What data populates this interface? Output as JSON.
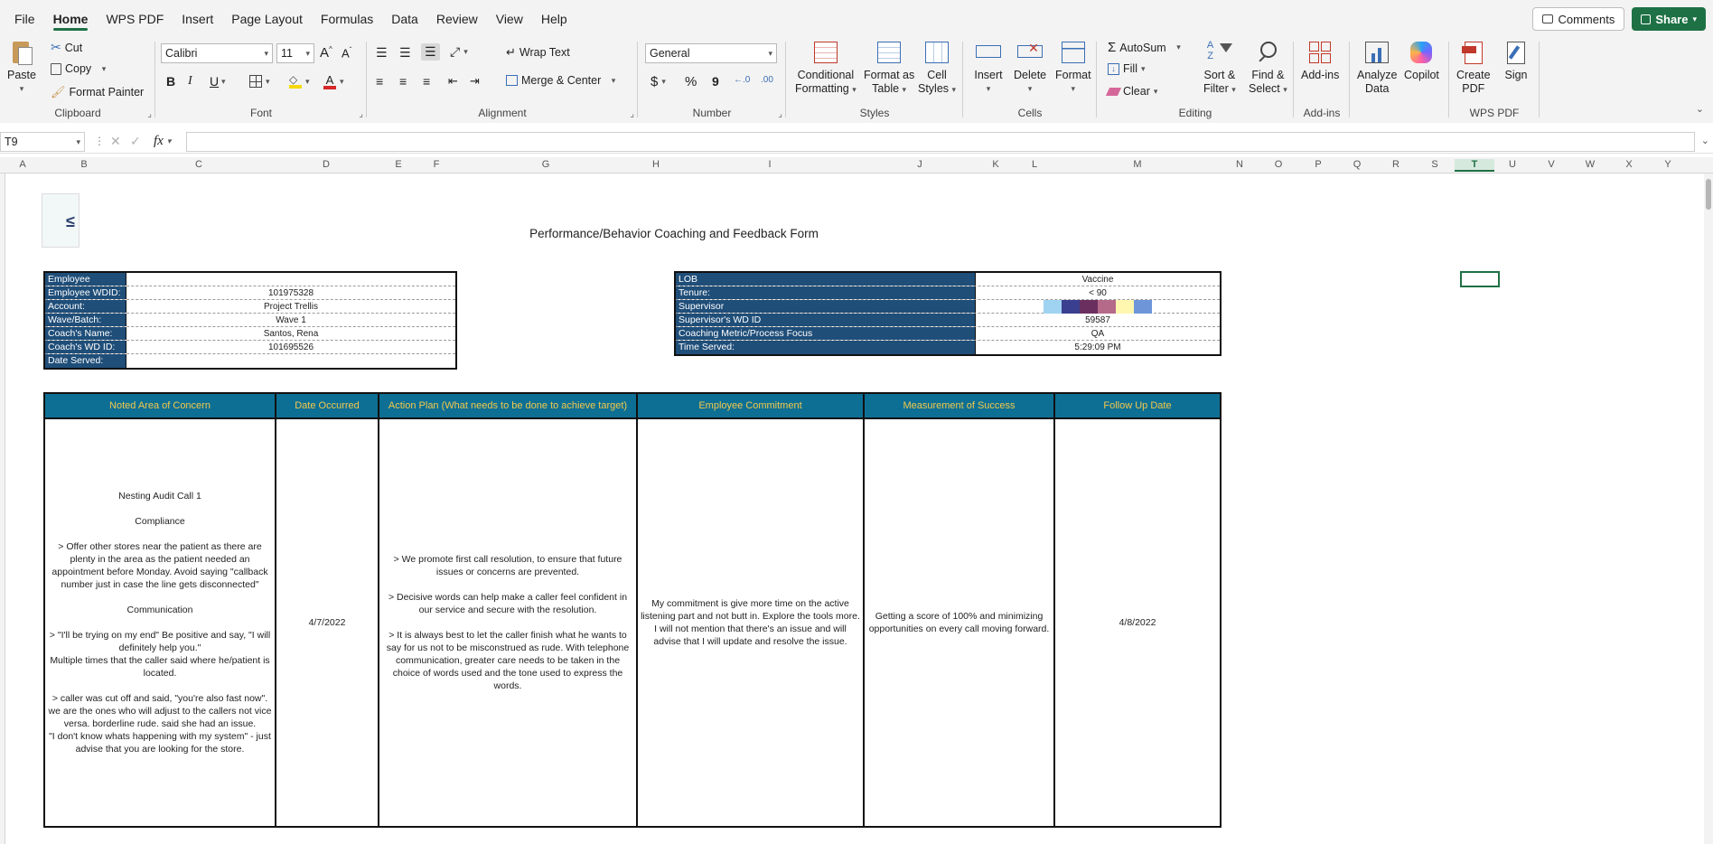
{
  "menu": {
    "tabs": [
      "File",
      "Home",
      "WPS PDF",
      "Insert",
      "Page Layout",
      "Formulas",
      "Data",
      "Review",
      "View",
      "Help"
    ],
    "comments_label": "Comments",
    "share_label": "Share"
  },
  "ribbon": {
    "clipboard": {
      "label": "Clipboard",
      "paste": "Paste",
      "cut": "Cut",
      "copy": "Copy",
      "format_painter": "Format Painter"
    },
    "font": {
      "label": "Font",
      "name": "Calibri",
      "size": "11",
      "bold": "B",
      "italic": "I",
      "underline": "U"
    },
    "alignment": {
      "label": "Alignment",
      "wrap": "Wrap Text",
      "merge": "Merge & Center"
    },
    "number": {
      "label": "Number",
      "format": "General",
      "currency": "$",
      "percent": "%",
      "comma": "9"
    },
    "styles": {
      "label": "Styles",
      "conditional_1": "Conditional",
      "conditional_2": "Formatting",
      "format_table_1": "Format as",
      "format_table_2": "Table",
      "cell_styles_1": "Cell",
      "cell_styles_2": "Styles"
    },
    "cells": {
      "label": "Cells",
      "insert": "Insert",
      "delete": "Delete",
      "format": "Format"
    },
    "editing": {
      "label": "Editing",
      "autosum": "AutoSum",
      "fill": "Fill",
      "clear": "Clear",
      "sort_1": "Sort &",
      "sort_2": "Filter",
      "find_1": "Find &",
      "find_2": "Select"
    },
    "addins": {
      "label": "Add-ins",
      "addins": "Add-ins",
      "analyze_1": "Analyze",
      "analyze_2": "Data",
      "copilot": "Copilot"
    },
    "wpspdf": {
      "label": "WPS PDF",
      "create_1": "Create",
      "create_2": "PDF",
      "sign": "Sign"
    }
  },
  "formula_bar": {
    "cell_ref": "T9",
    "fx": "fx",
    "content": ""
  },
  "columns": [
    "A",
    "B",
    "C",
    "D",
    "E",
    "F",
    "G",
    "H",
    "I",
    "J",
    "K",
    "L",
    "M",
    "N",
    "O",
    "P",
    "Q",
    "R",
    "S",
    "T",
    "U",
    "V",
    "W",
    "X",
    "Y"
  ],
  "sheet": {
    "title": "Performance/Behavior Coaching and Feedback Form",
    "logo_glyph": "≤",
    "left_info": [
      {
        "label": "Employee",
        "value": ""
      },
      {
        "label": "Employee WDID:",
        "value": "101975328"
      },
      {
        "label": "Account:",
        "value": "Project Trellis"
      },
      {
        "label": "Wave/Batch:",
        "value": "Wave 1"
      },
      {
        "label": "Coach's Name:",
        "value": "Santos, Rena"
      },
      {
        "label": "Coach's WD ID:",
        "value": "101695526"
      },
      {
        "label": "Date Served:",
        "value": ""
      }
    ],
    "right_info": [
      {
        "label": "LOB",
        "value": "Vaccine"
      },
      {
        "label": "Tenure:",
        "value": "< 90"
      },
      {
        "label": "Supervisor",
        "value": ""
      },
      {
        "label": "Supervisor's WD ID",
        "value": "59587"
      },
      {
        "label": "Coaching Metric/Process Focus",
        "value": "QA"
      },
      {
        "label": "Time Served:",
        "value": "5:29:09 PM"
      }
    ],
    "supervisor_swatches": [
      "#9fd3f1",
      "#3a3f8f",
      "#6a2f5f",
      "#b56a8a",
      "#fff6b0",
      "#6d95d8"
    ],
    "coaching_headers": [
      "Noted Area of Concern",
      "Date Occurred",
      "Action Plan (What needs to be done to achieve target)",
      "Employee Commitment",
      "Measurement of Success",
      "Follow Up Date"
    ],
    "coaching_row": {
      "concern": "Nesting Audit Call 1\n\nCompliance\n\n> Offer other stores near the patient as there are plenty in the area as the patient needed an appointment before Monday. Avoid saying \"callback number just in case the line gets disconnected\"\n\nCommunication\n\n> \"I'll be trying on my end\" Be positive and say, \"I will definitely help you.\"\nMultiple times that the caller said where he/patient is located.\n\n> caller was cut off and said, \"you're also fast now\". we are the ones who will adjust to the callers not vice versa. borderline rude. said she had an issue.\n\"I don't know whats happening with my system\" - just advise that you are looking for the store.",
      "date_occurred": "4/7/2022",
      "action_plan": "> We promote first call resolution, to ensure that future issues or concerns are prevented.\n\n> Decisive words can help make a caller feel confident in our service and secure with the resolution.\n\n> It is always best to let the caller finish what he wants to say for us not to be misconstrued as rude. With telephone communication, greater care needs to be taken in the choice of words used and the tone used to express the words.",
      "commitment": "My commitment is give more time on the active listening part and not butt in. Explore the tools more. I will not mention that there's an issue and will advise that I will update and resolve the issue.",
      "measurement": "Getting a score of 100% and minimizing opportunities on every call moving forward.",
      "follow_up": "4/8/2022"
    }
  }
}
